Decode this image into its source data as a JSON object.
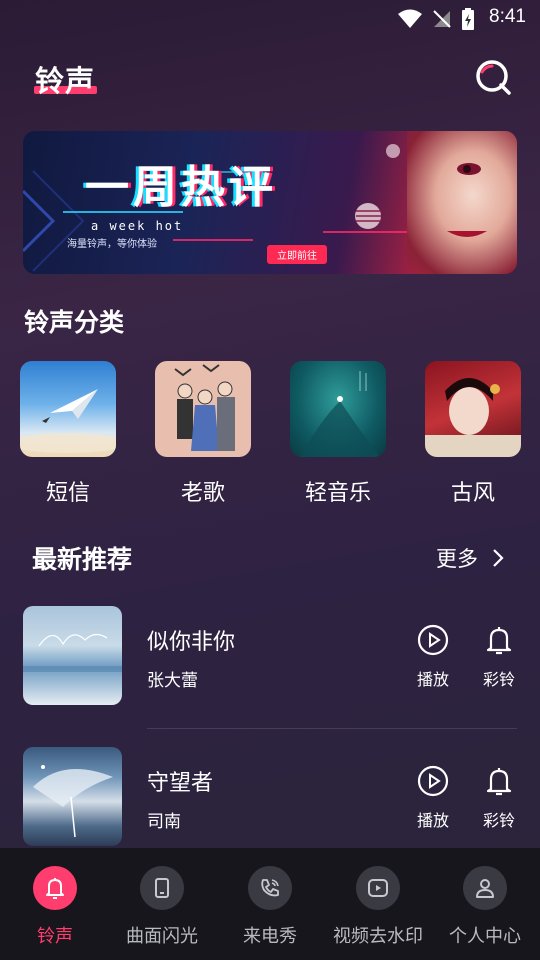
{
  "status_bar": {
    "time": "8:41"
  },
  "header": {
    "title": "铃声"
  },
  "banner": {
    "title": "一周热评",
    "subtitle": "a week hot",
    "description": "海量铃声，等你体验",
    "button": "立即前往"
  },
  "categories": {
    "title": "铃声分类",
    "items": [
      {
        "label": "短信"
      },
      {
        "label": "老歌"
      },
      {
        "label": "轻音乐"
      },
      {
        "label": "古风"
      }
    ]
  },
  "recommend": {
    "title": "最新推荐",
    "more": "更多",
    "songs": [
      {
        "title": "似你非你",
        "artist": "张大蕾",
        "play_label": "播放",
        "ring_label": "彩铃"
      },
      {
        "title": "守望者",
        "artist": "司南",
        "play_label": "播放",
        "ring_label": "彩铃"
      }
    ]
  },
  "bottom_nav": {
    "items": [
      {
        "label": "铃声",
        "icon": "bell-icon",
        "active": true
      },
      {
        "label": "曲面闪光",
        "icon": "phone-icon",
        "active": false
      },
      {
        "label": "来电秀",
        "icon": "call-icon",
        "active": false
      },
      {
        "label": "视频去水印",
        "icon": "video-icon",
        "active": false
      },
      {
        "label": "个人中心",
        "icon": "user-icon",
        "active": false
      }
    ]
  },
  "colors": {
    "accent": "#ff3d6e",
    "nav_bg": "#17161c"
  }
}
